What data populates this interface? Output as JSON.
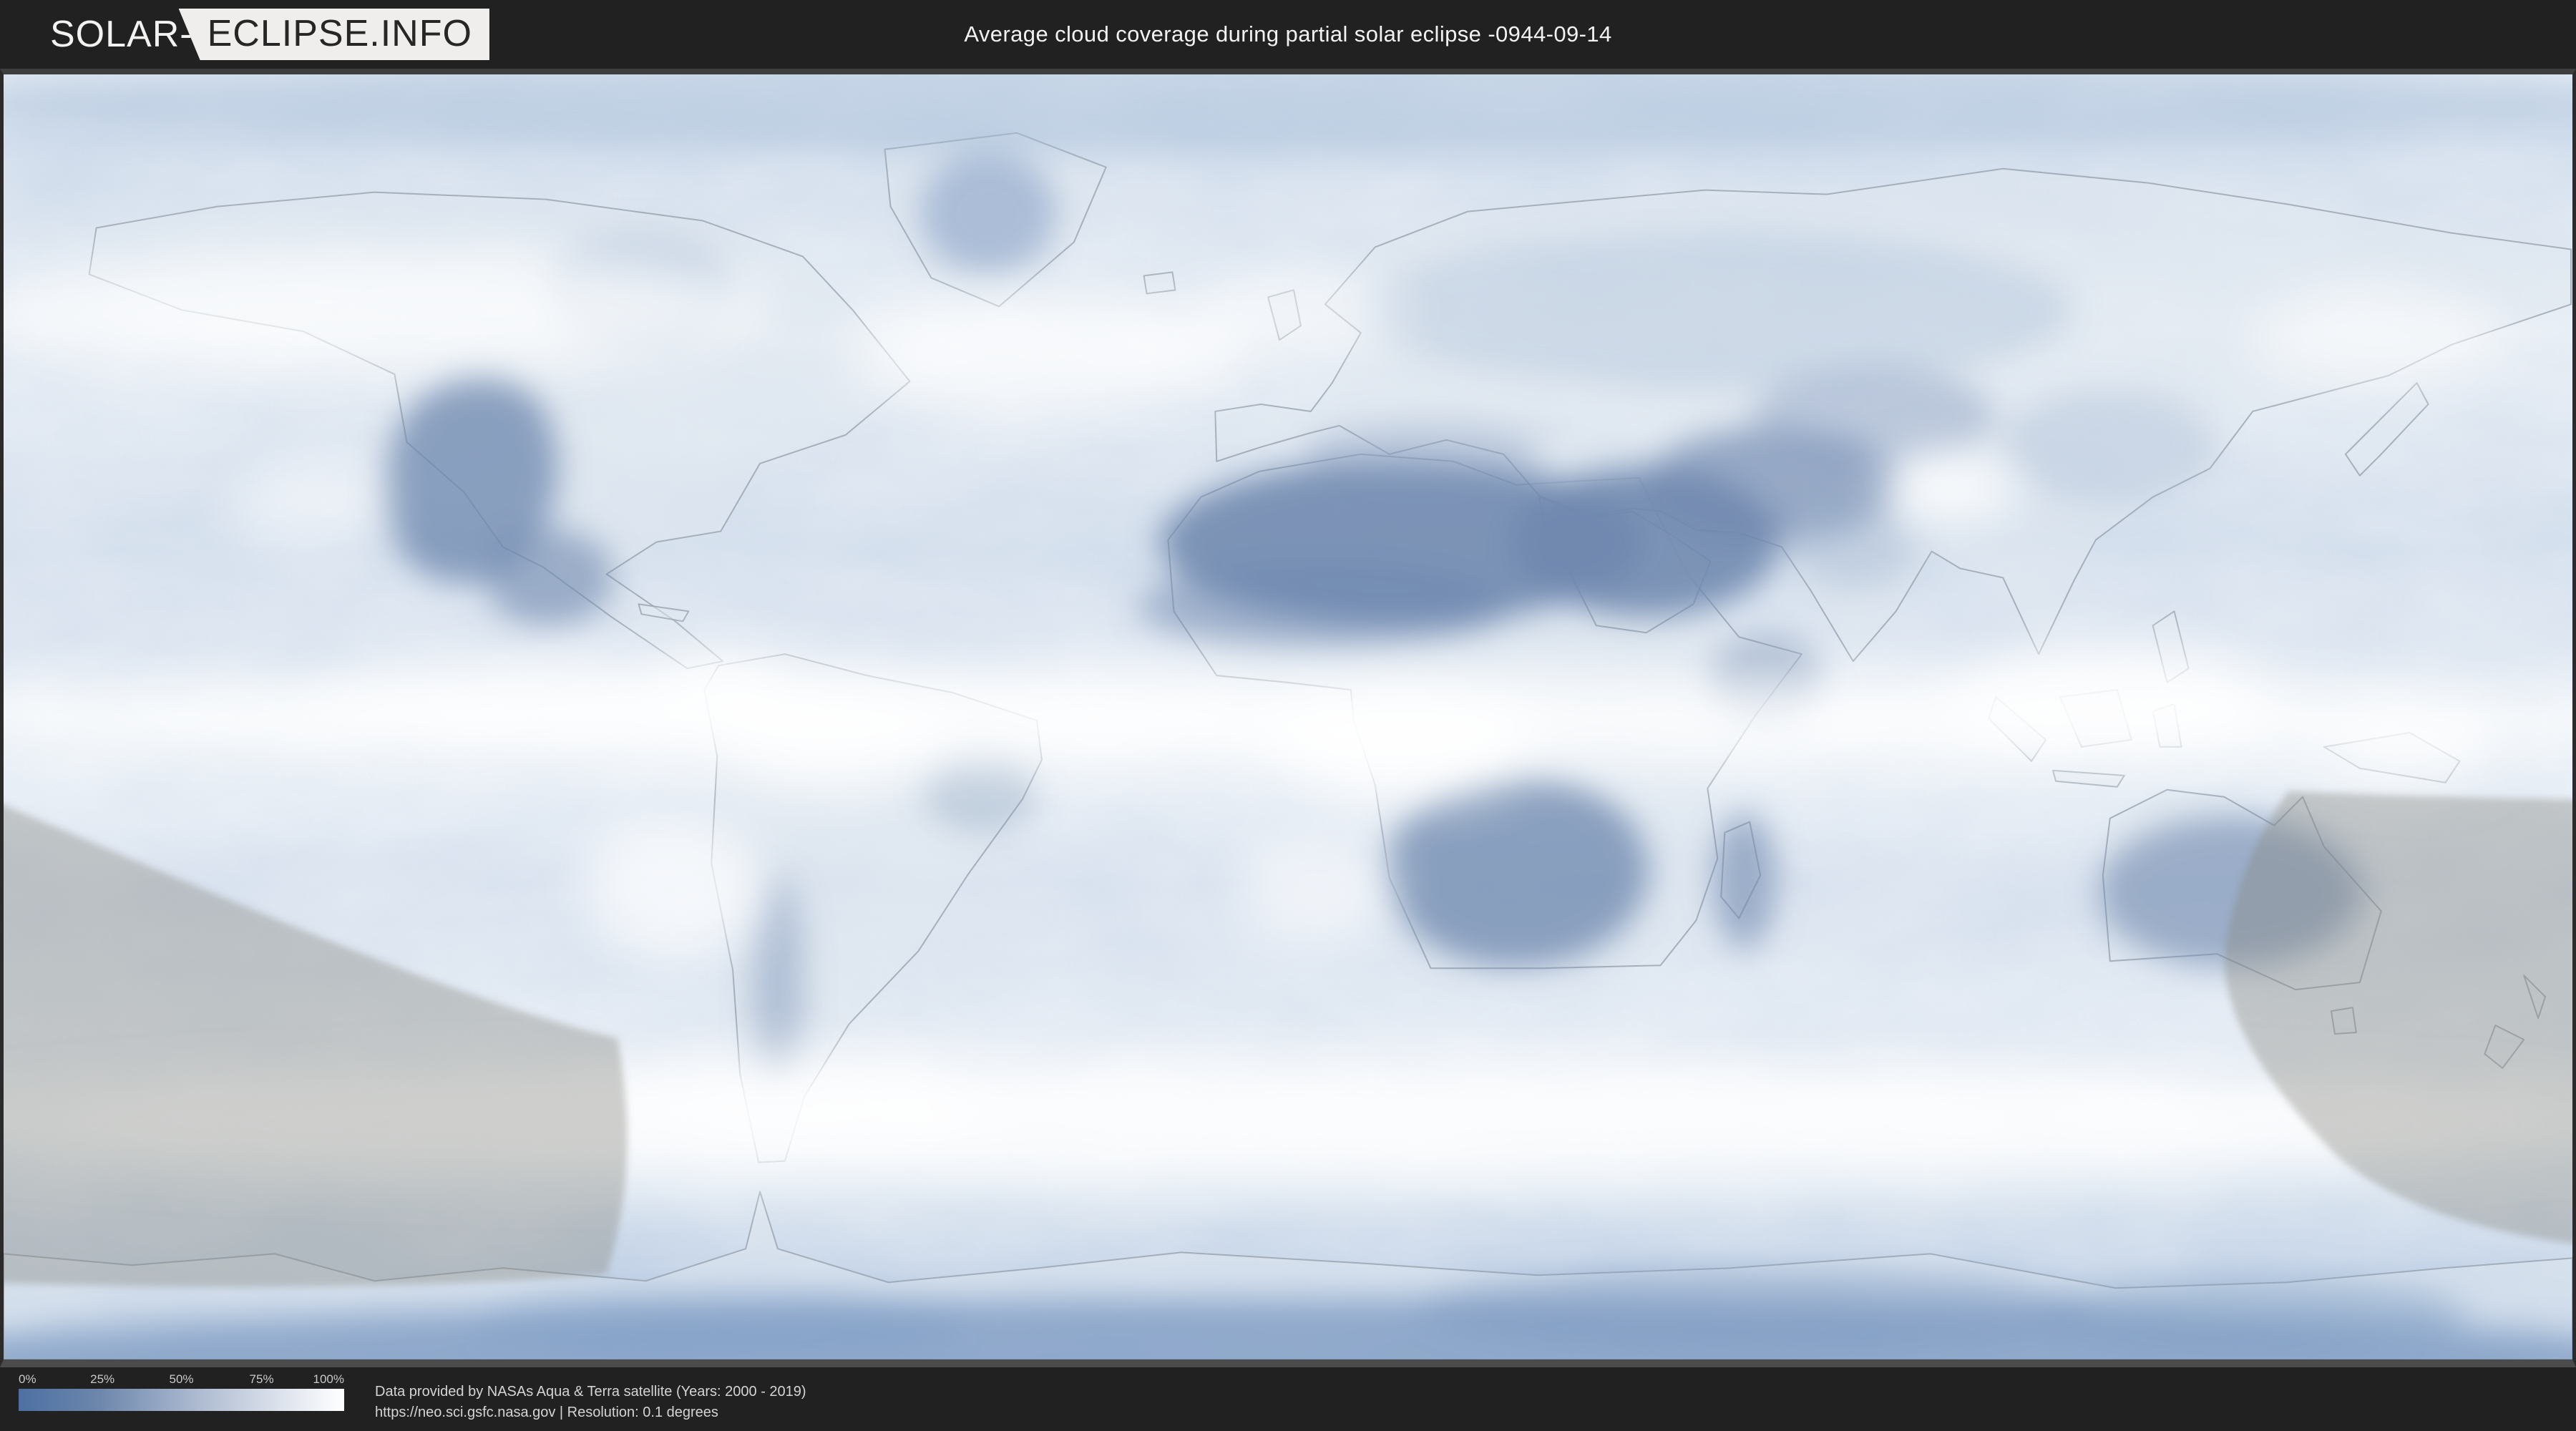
{
  "header": {
    "logo": {
      "prefix": "SOLAR-",
      "suffix": "ECLIPSE.INFO"
    },
    "title": "Average cloud coverage during partial solar eclipse -0944-09-14"
  },
  "map": {
    "type": "world-cloud-coverage-map",
    "projection": "equirectangular",
    "overlays": [
      "eclipse-visibility-region-south-pacific-left",
      "eclipse-visibility-region-australia-pacific-right"
    ]
  },
  "legend": {
    "ticks": [
      "0%",
      "25%",
      "50%",
      "75%",
      "100%"
    ],
    "gradient": [
      "#4c70a3",
      "#6d87ac",
      "#a3b2cb",
      "#d3dae6",
      "#ffffff"
    ]
  },
  "footer": {
    "credit_line1": "Data provided by NASAs Aqua & Terra satellite (Years: 2000 - 2019)",
    "credit_line2": "https://neo.sci.gsfc.nasa.gov | Resolution: 0.1 degrees"
  },
  "colors": {
    "header_bg": "#212121",
    "logo_box_bg": "#efeeec",
    "logo_text_dark": "#262626",
    "logo_text_light": "#f3f2f0",
    "map_frame": "#3e3e3e",
    "ocean_light": "#e6edf5",
    "cloud_low_dark_blue": "#6e87ae",
    "cloud_high_white": "#ffffff",
    "eclipse_overlay_gray": "#85857e",
    "footer_text": "#d4d4d4"
  }
}
